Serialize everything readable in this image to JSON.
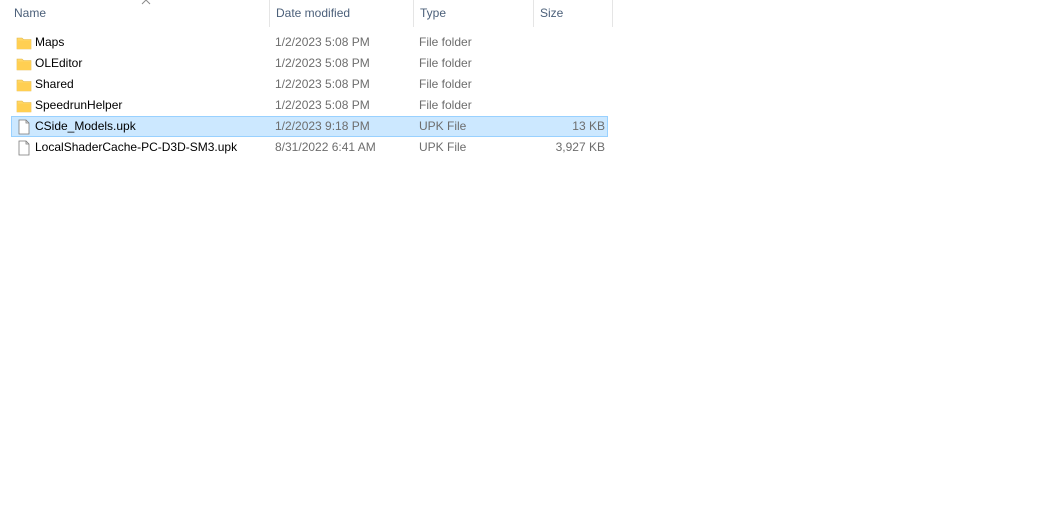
{
  "columns": {
    "name": "Name",
    "date": "Date modified",
    "type": "Type",
    "size": "Size"
  },
  "rows": [
    {
      "name": "Maps",
      "date": "1/2/2023 5:08 PM",
      "type": "File folder",
      "size": "",
      "icon": "folder-icon",
      "selected": false
    },
    {
      "name": "OLEditor",
      "date": "1/2/2023 5:08 PM",
      "type": "File folder",
      "size": "",
      "icon": "folder-icon",
      "selected": false
    },
    {
      "name": "Shared",
      "date": "1/2/2023 5:08 PM",
      "type": "File folder",
      "size": "",
      "icon": "folder-icon",
      "selected": false
    },
    {
      "name": "SpeedrunHelper",
      "date": "1/2/2023 5:08 PM",
      "type": "File folder",
      "size": "",
      "icon": "folder-icon",
      "selected": false
    },
    {
      "name": "CSide_Models.upk",
      "date": "1/2/2023 9:18 PM",
      "type": "UPK File",
      "size": "13 KB",
      "icon": "file-icon",
      "selected": true
    },
    {
      "name": "LocalShaderCache-PC-D3D-SM3.upk",
      "date": "8/31/2022 6:41 AM",
      "type": "UPK File",
      "size": "3,927 KB",
      "icon": "file-icon",
      "selected": false
    }
  ],
  "colors": {
    "selection_bg": "#cce8ff",
    "selection_border": "#99d1ff",
    "folder": "#ffd766",
    "header_text": "#4c607a"
  }
}
